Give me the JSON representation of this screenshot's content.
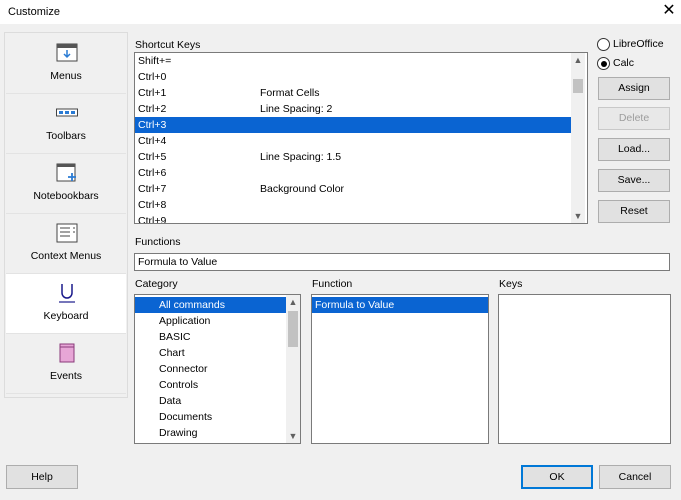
{
  "window": {
    "title": "Customize",
    "close_glyph": "✕"
  },
  "sidebar": {
    "items": [
      {
        "label": "Menus",
        "icon": "menus-icon"
      },
      {
        "label": "Toolbars",
        "icon": "toolbars-icon"
      },
      {
        "label": "Notebookbars",
        "icon": "notebookbars-icon"
      },
      {
        "label": "Context Menus",
        "icon": "context-menus-icon"
      },
      {
        "label": "Keyboard",
        "icon": "keyboard-icon",
        "selected": true
      },
      {
        "label": "Events",
        "icon": "events-icon"
      }
    ]
  },
  "shortcut_keys": {
    "label": "Shortcut Keys",
    "rows": [
      {
        "key": "Shift+=",
        "command": ""
      },
      {
        "key": "Ctrl+0",
        "command": ""
      },
      {
        "key": "Ctrl+1",
        "command": "Format Cells"
      },
      {
        "key": "Ctrl+2",
        "command": "Line Spacing: 2"
      },
      {
        "key": "Ctrl+3",
        "command": "",
        "selected": true
      },
      {
        "key": "Ctrl+4",
        "command": ""
      },
      {
        "key": "Ctrl+5",
        "command": "Line Spacing: 1.5"
      },
      {
        "key": "Ctrl+6",
        "command": ""
      },
      {
        "key": "Ctrl+7",
        "command": "Background Color"
      },
      {
        "key": "Ctrl+8",
        "command": ""
      },
      {
        "key": "Ctrl+9",
        "command": ""
      }
    ]
  },
  "scope": {
    "options": [
      {
        "label": "LibreOffice",
        "checked": false
      },
      {
        "label": "Calc",
        "checked": true
      }
    ]
  },
  "buttons": {
    "assign": "Assign",
    "delete": "Delete",
    "load": "Load...",
    "save": "Save...",
    "reset": "Reset",
    "help": "Help",
    "ok": "OK",
    "cancel": "Cancel"
  },
  "functions": {
    "label": "Functions",
    "value": "Formula to Value"
  },
  "category": {
    "label": "Category",
    "items": [
      "All commands",
      "Application",
      "BASIC",
      "Chart",
      "Connector",
      "Controls",
      "Data",
      "Documents",
      "Drawing"
    ],
    "selected_index": 0
  },
  "function": {
    "label": "Function",
    "items": [
      "Formula to Value"
    ],
    "selected_index": 0
  },
  "keys": {
    "label": "Keys",
    "items": []
  },
  "colors": {
    "accent": "#0a64d2",
    "default_button_border": "#0078d7"
  }
}
